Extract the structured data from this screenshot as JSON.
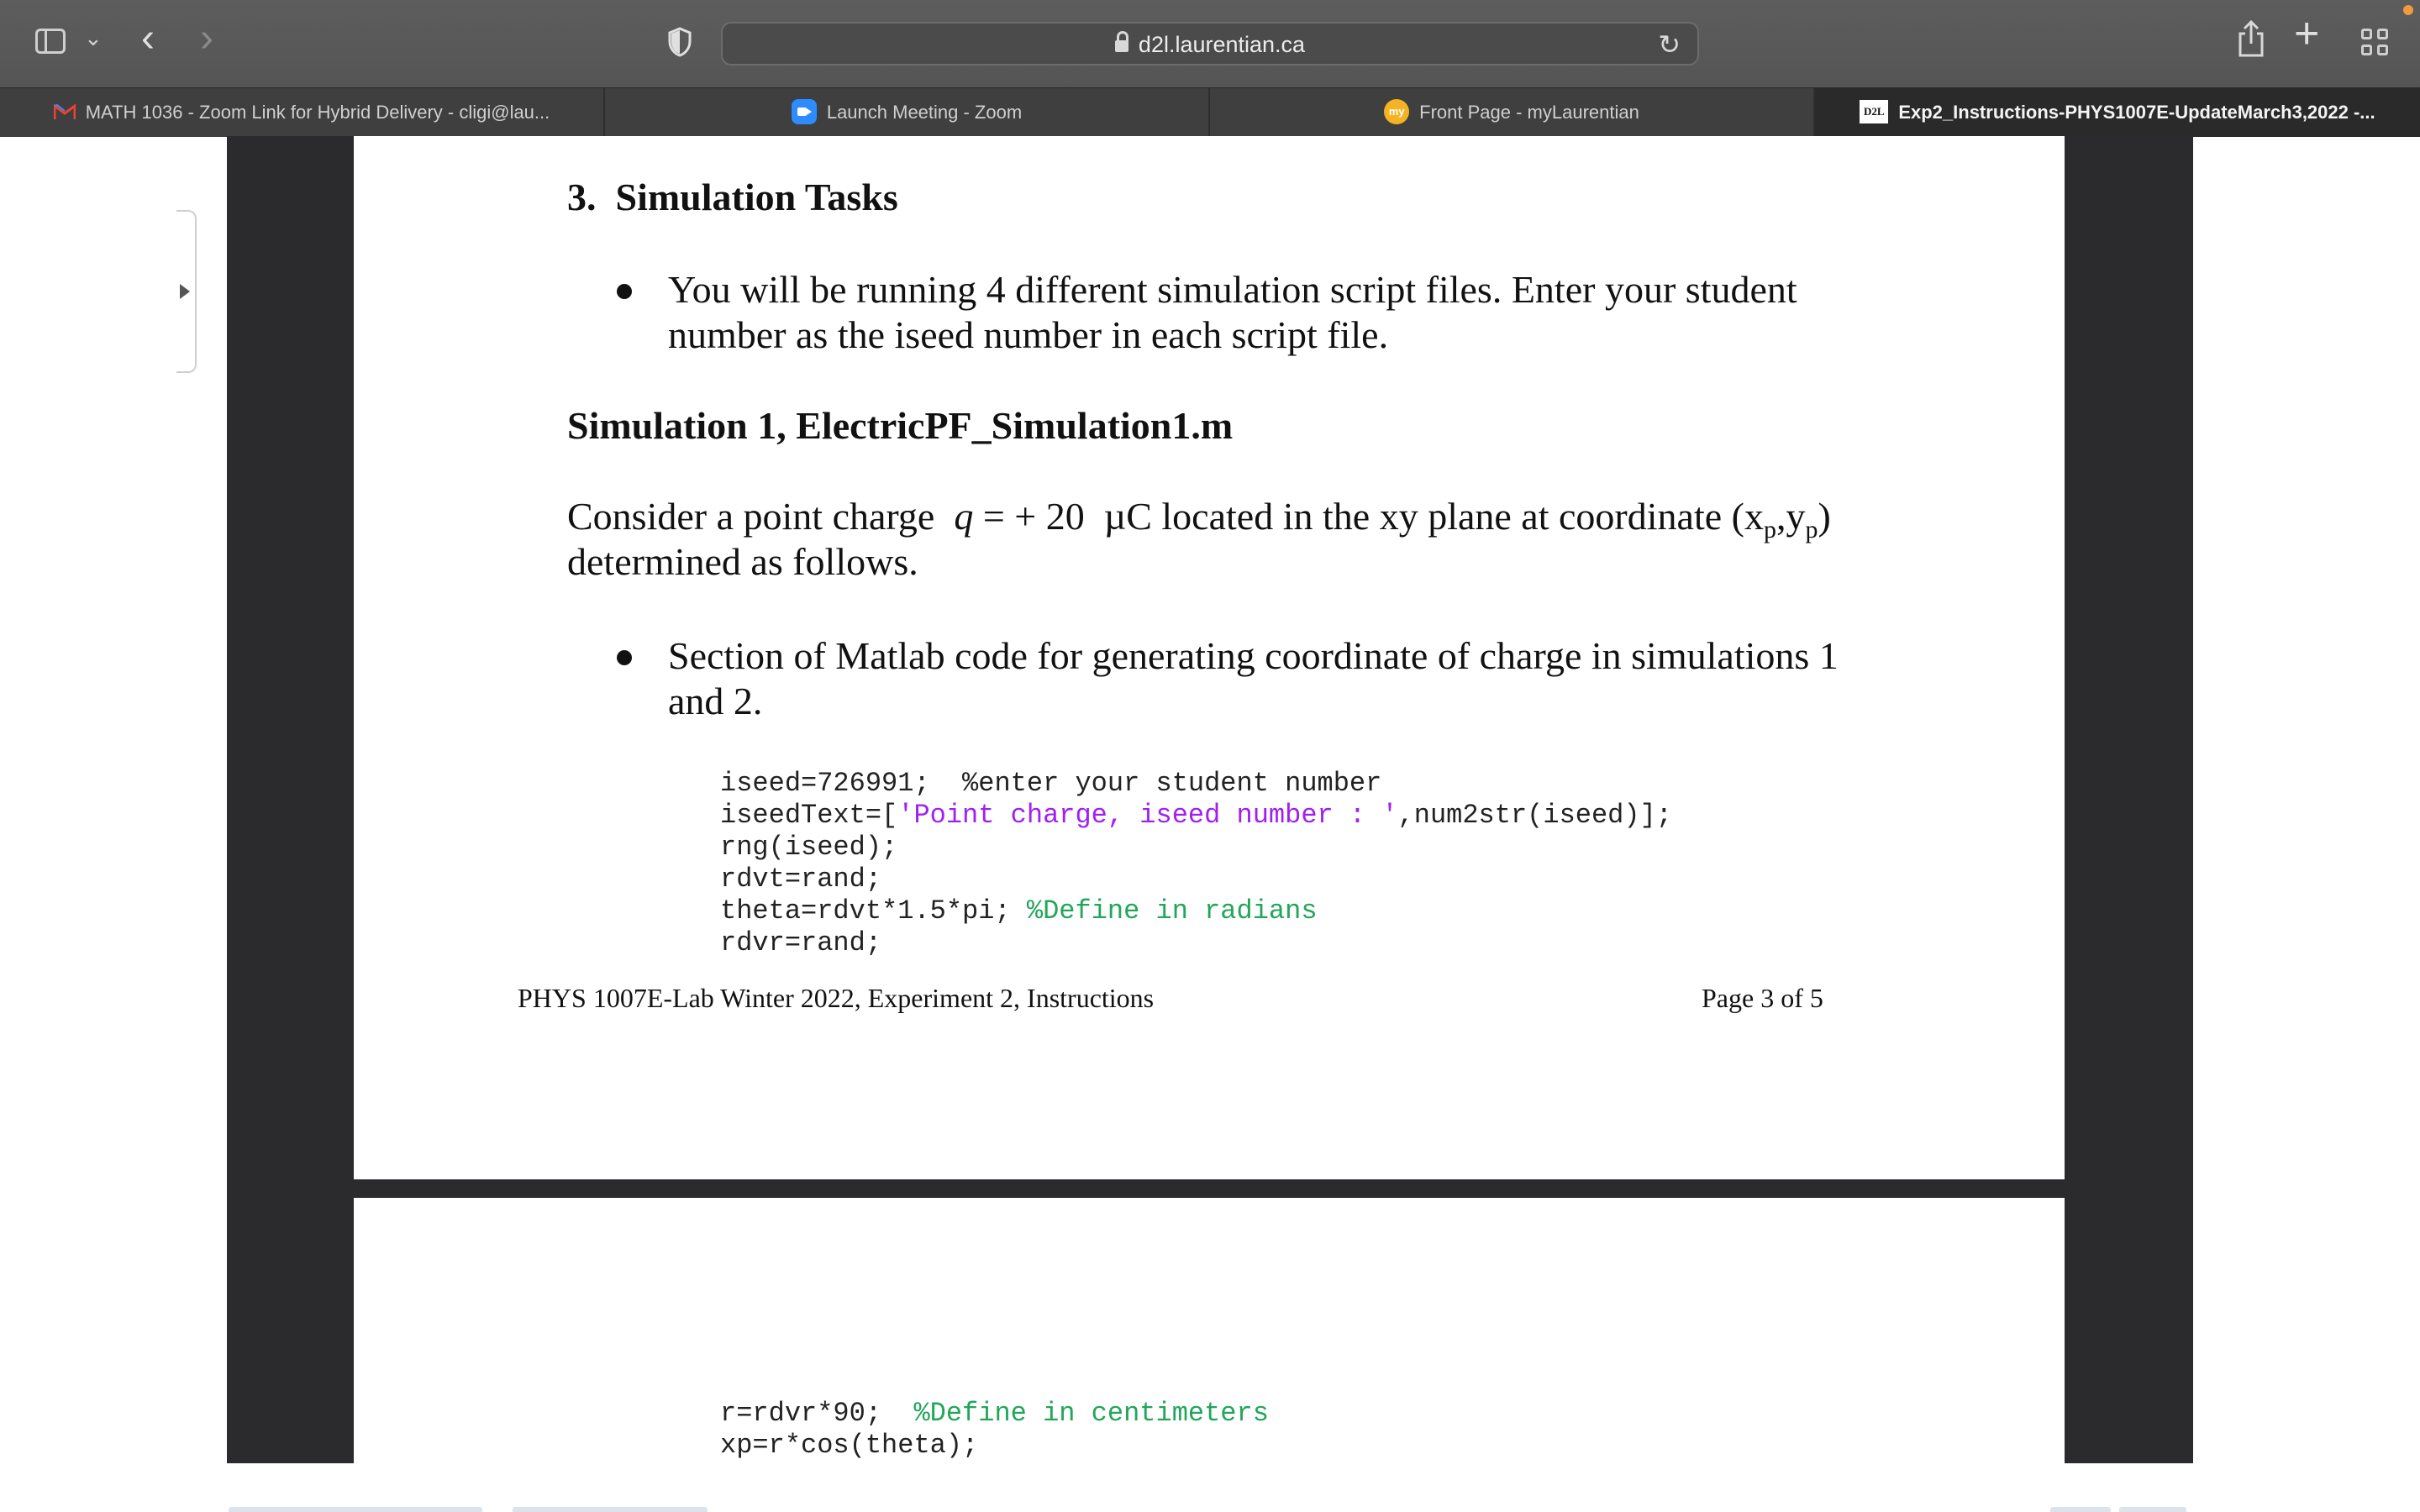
{
  "browser": {
    "url": "d2l.laurentian.ca",
    "tabs": [
      {
        "label": "MATH 1036 - Zoom Link for Hybrid Delivery - cligi@lau...",
        "icon": "gmail-icon"
      },
      {
        "label": "Launch Meeting - Zoom",
        "icon": "zoom-icon"
      },
      {
        "label": "Front Page - myLaurentian",
        "icon": "mylaurentian-icon",
        "icon_text": "my"
      },
      {
        "label": "Exp2_Instructions-PHYS1007E-UpdateMarch3,2022 -...",
        "icon": "d2l-icon",
        "icon_text": "D2L",
        "active": true
      }
    ],
    "colors": {
      "toolbar": "#555555",
      "tabbar": "#3f3f3f",
      "active_tab": "#2a2a2a",
      "viewer_bg": "#2b2b2e"
    }
  },
  "document": {
    "section_number": "3.",
    "section_title": "Simulation Tasks",
    "bullet1_line1": "You will be running 4 different simulation script files. Enter your student",
    "bullet1_line2": "number as the iseed number in each script file.",
    "sim_heading": "Simulation 1, ElectricPF_Simulation1.m",
    "para": {
      "prefix": "Consider a point charge",
      "q_symbol": "q",
      "equals": "= + 20",
      "unit": "µC",
      "middle": "located in the xy plane at coordinate (x",
      "sub_p1": "p",
      "comma": ",y",
      "sub_p2": "p",
      "close": ")",
      "line2": "determined as follows."
    },
    "bullet2_line1": "Section of Matlab code for generating coordinate of charge in simulations 1",
    "bullet2_line2": "and 2.",
    "code1": {
      "l1_code": "iseed=726991;",
      "l1_cmt": "%enter your student number",
      "l2_a": "iseedText=[",
      "l2_str": "'Point charge, iseed number : '",
      "l2_b": ",num2str(iseed)];",
      "l3": "rng(iseed);",
      "l4": "rdvt=rand;",
      "l5_code": "theta=rdvt*1.5*pi;",
      "l5_cmt": "%Define in radians",
      "l6": "rdvr=rand;"
    },
    "footer_left": "PHYS 1007E-Lab Winter 2022, Experiment 2, Instructions",
    "footer_right": "Page 3 of 5",
    "code2": {
      "l1_code": "r=rdvr*90;",
      "l1_cmt": "%Define in centimeters",
      "l2": "xp=r*cos(theta);"
    },
    "colors": {
      "string": "#a020f0",
      "comment": "#22a65a"
    }
  }
}
